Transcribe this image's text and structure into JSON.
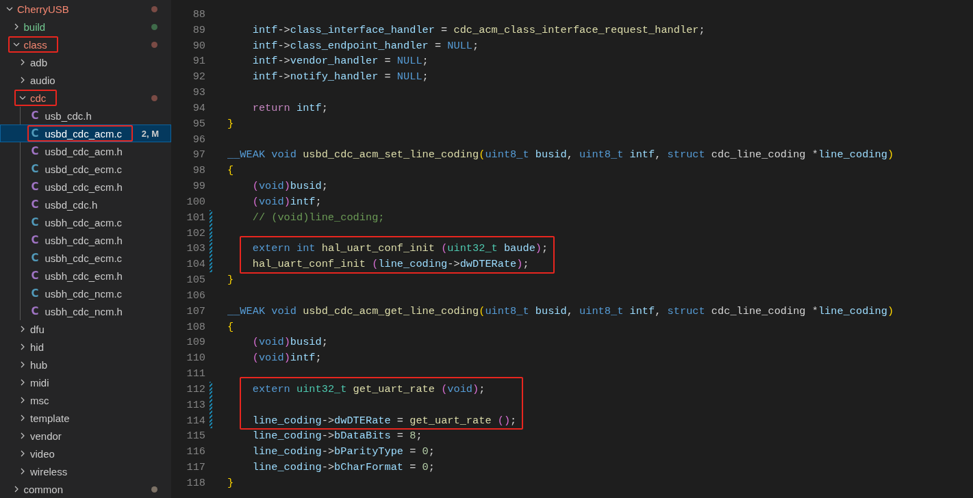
{
  "explorer": {
    "tree": [
      {
        "label": "CherryUSB",
        "kind": "folder",
        "expanded": true,
        "has_errors": true,
        "untracked": false,
        "color": "#7a4b45",
        "annotated": false,
        "selected": false,
        "children": [
          {
            "label": "build",
            "kind": "folder",
            "expanded": false,
            "has_errors": false,
            "untracked": true,
            "color": "#3f6b4a",
            "annotated": false,
            "selected": false
          },
          {
            "label": "class",
            "kind": "folder",
            "expanded": true,
            "has_errors": true,
            "untracked": false,
            "color": "#7a4b45",
            "annotated": true,
            "selected": false,
            "children": [
              {
                "label": "adb",
                "kind": "folder",
                "expanded": false,
                "has_errors": false,
                "untracked": false,
                "annotated": false,
                "selected": false
              },
              {
                "label": "audio",
                "kind": "folder",
                "expanded": false,
                "has_errors": false,
                "untracked": false,
                "annotated": false,
                "selected": false
              },
              {
                "label": "cdc",
                "kind": "folder",
                "expanded": true,
                "has_errors": true,
                "untracked": false,
                "color": "#7a4b45",
                "annotated": true,
                "selected": false,
                "children": [
                  {
                    "label": "usb_cdc.h",
                    "kind": "header",
                    "icon": "C",
                    "has_errors": false,
                    "untracked": false,
                    "annotated": false,
                    "selected": false
                  },
                  {
                    "label": "usbd_cdc_acm.c",
                    "kind": "source",
                    "icon": "C",
                    "has_errors": false,
                    "untracked": false,
                    "badge": "2, M",
                    "annotated": true,
                    "selected": true
                  },
                  {
                    "label": "usbd_cdc_acm.h",
                    "kind": "header",
                    "icon": "C",
                    "has_errors": false,
                    "untracked": false,
                    "annotated": false,
                    "selected": false
                  },
                  {
                    "label": "usbd_cdc_ecm.c",
                    "kind": "source",
                    "icon": "C",
                    "has_errors": false,
                    "untracked": false,
                    "annotated": false,
                    "selected": false
                  },
                  {
                    "label": "usbd_cdc_ecm.h",
                    "kind": "header",
                    "icon": "C",
                    "has_errors": false,
                    "untracked": false,
                    "annotated": false,
                    "selected": false
                  },
                  {
                    "label": "usbd_cdc.h",
                    "kind": "header",
                    "icon": "C",
                    "has_errors": false,
                    "untracked": false,
                    "annotated": false,
                    "selected": false
                  },
                  {
                    "label": "usbh_cdc_acm.c",
                    "kind": "source",
                    "icon": "C",
                    "has_errors": false,
                    "untracked": false,
                    "annotated": false,
                    "selected": false
                  },
                  {
                    "label": "usbh_cdc_acm.h",
                    "kind": "header",
                    "icon": "C",
                    "has_errors": false,
                    "untracked": false,
                    "annotated": false,
                    "selected": false
                  },
                  {
                    "label": "usbh_cdc_ecm.c",
                    "kind": "source",
                    "icon": "C",
                    "has_errors": false,
                    "untracked": false,
                    "annotated": false,
                    "selected": false
                  },
                  {
                    "label": "usbh_cdc_ecm.h",
                    "kind": "header",
                    "icon": "C",
                    "has_errors": false,
                    "untracked": false,
                    "annotated": false,
                    "selected": false
                  },
                  {
                    "label": "usbh_cdc_ncm.c",
                    "kind": "source",
                    "icon": "C",
                    "has_errors": false,
                    "untracked": false,
                    "annotated": false,
                    "selected": false
                  },
                  {
                    "label": "usbh_cdc_ncm.h",
                    "kind": "header",
                    "icon": "C",
                    "has_errors": false,
                    "untracked": false,
                    "annotated": false,
                    "selected": false
                  }
                ]
              },
              {
                "label": "dfu",
                "kind": "folder",
                "expanded": false,
                "has_errors": false,
                "untracked": false,
                "annotated": false,
                "selected": false
              },
              {
                "label": "hid",
                "kind": "folder",
                "expanded": false,
                "has_errors": false,
                "untracked": false,
                "annotated": false,
                "selected": false
              },
              {
                "label": "hub",
                "kind": "folder",
                "expanded": false,
                "has_errors": false,
                "untracked": false,
                "annotated": false,
                "selected": false
              },
              {
                "label": "midi",
                "kind": "folder",
                "expanded": false,
                "has_errors": false,
                "untracked": false,
                "annotated": false,
                "selected": false
              },
              {
                "label": "msc",
                "kind": "folder",
                "expanded": false,
                "has_errors": false,
                "untracked": false,
                "annotated": false,
                "selected": false
              },
              {
                "label": "template",
                "kind": "folder",
                "expanded": false,
                "has_errors": false,
                "untracked": false,
                "annotated": false,
                "selected": false
              },
              {
                "label": "vendor",
                "kind": "folder",
                "expanded": false,
                "has_errors": false,
                "untracked": false,
                "annotated": false,
                "selected": false
              },
              {
                "label": "video",
                "kind": "folder",
                "expanded": false,
                "has_errors": false,
                "untracked": false,
                "annotated": false,
                "selected": false
              },
              {
                "label": "wireless",
                "kind": "folder",
                "expanded": false,
                "has_errors": false,
                "untracked": false,
                "annotated": false,
                "selected": false
              }
            ]
          },
          {
            "label": "common",
            "kind": "folder",
            "expanded": false,
            "has_errors": false,
            "untracked": false,
            "color": "#7d7266",
            "annotated": false,
            "selected": false
          }
        ]
      }
    ]
  },
  "editor": {
    "blocks": [
      {
        "annotated": false,
        "lines": [
          {
            "number": "88",
            "modified": false
          },
          {
            "number": "89",
            "modified": false,
            "tokens": [
              {
                "kind": "variable",
                "text": "    intf"
              },
              {
                "kind": "plain",
                "text": "->"
              },
              {
                "kind": "variable",
                "text": "class_interface_handler"
              },
              {
                "kind": "plain",
                "text": " = "
              },
              {
                "kind": "function",
                "text": "cdc_acm_class_interface_request_handler"
              },
              {
                "kind": "plain",
                "text": ";"
              }
            ]
          },
          {
            "number": "90",
            "modified": false,
            "tokens": [
              {
                "kind": "variable",
                "text": "    intf"
              },
              {
                "kind": "plain",
                "text": "->"
              },
              {
                "kind": "variable",
                "text": "class_endpoint_handler"
              },
              {
                "kind": "plain",
                "text": " = "
              },
              {
                "kind": "keyword",
                "text": "NULL"
              },
              {
                "kind": "plain",
                "text": ";"
              }
            ]
          },
          {
            "number": "91",
            "modified": false,
            "tokens": [
              {
                "kind": "variable",
                "text": "    intf"
              },
              {
                "kind": "plain",
                "text": "->"
              },
              {
                "kind": "variable",
                "text": "vendor_handler"
              },
              {
                "kind": "plain",
                "text": " = "
              },
              {
                "kind": "keyword",
                "text": "NULL"
              },
              {
                "kind": "plain",
                "text": ";"
              }
            ]
          },
          {
            "number": "92",
            "modified": false,
            "tokens": [
              {
                "kind": "variable",
                "text": "    intf"
              },
              {
                "kind": "plain",
                "text": "->"
              },
              {
                "kind": "variable",
                "text": "notify_handler"
              },
              {
                "kind": "plain",
                "text": " = "
              },
              {
                "kind": "keyword",
                "text": "NULL"
              },
              {
                "kind": "plain",
                "text": ";"
              }
            ]
          },
          {
            "number": "93",
            "modified": false
          },
          {
            "number": "94",
            "modified": false,
            "tokens": [
              {
                "kind": "control",
                "text": "    return "
              },
              {
                "kind": "variable",
                "text": "intf"
              },
              {
                "kind": "plain",
                "text": ";"
              }
            ]
          },
          {
            "number": "95",
            "modified": false,
            "tokens": [
              {
                "kind": "brace",
                "text": "}"
              }
            ]
          },
          {
            "number": "96",
            "modified": false
          },
          {
            "number": "97",
            "modified": false,
            "tokens": [
              {
                "kind": "keyword",
                "text": "__WEAK void "
              },
              {
                "kind": "function",
                "text": "usbd_cdc_acm_set_line_coding"
              },
              {
                "kind": "brace",
                "text": "("
              },
              {
                "kind": "keyword",
                "text": "uint8_t "
              },
              {
                "kind": "variable",
                "text": "busid"
              },
              {
                "kind": "plain",
                "text": ", "
              },
              {
                "kind": "keyword",
                "text": "uint8_t "
              },
              {
                "kind": "variable",
                "text": "intf"
              },
              {
                "kind": "plain",
                "text": ", "
              },
              {
                "kind": "keyword",
                "text": "struct "
              },
              {
                "kind": "plain",
                "text": "cdc_line_coding *"
              },
              {
                "kind": "variable",
                "text": "line_coding"
              },
              {
                "kind": "brace",
                "text": ")"
              }
            ]
          },
          {
            "number": "98",
            "modified": false,
            "tokens": [
              {
                "kind": "brace",
                "text": "{"
              }
            ]
          },
          {
            "number": "99",
            "modified": false,
            "tokens": [
              {
                "kind": "paren",
                "text": "    ("
              },
              {
                "kind": "keyword",
                "text": "void"
              },
              {
                "kind": "paren",
                "text": ")"
              },
              {
                "kind": "variable",
                "text": "busid"
              },
              {
                "kind": "plain",
                "text": ";"
              }
            ]
          },
          {
            "number": "100",
            "modified": false,
            "tokens": [
              {
                "kind": "paren",
                "text": "    ("
              },
              {
                "kind": "keyword",
                "text": "void"
              },
              {
                "kind": "paren",
                "text": ")"
              },
              {
                "kind": "variable",
                "text": "intf"
              },
              {
                "kind": "plain",
                "text": ";"
              }
            ]
          },
          {
            "number": "101",
            "modified": true,
            "tokens": [
              {
                "kind": "comment",
                "text": "    // (void)line_coding;"
              }
            ]
          },
          {
            "number": "102",
            "modified": true
          }
        ]
      },
      {
        "annotated": true,
        "lines": [
          {
            "number": "103",
            "modified": true,
            "tokens": [
              {
                "kind": "keyword",
                "text": "    extern int "
              },
              {
                "kind": "function",
                "text": "hal_uart_conf_init "
              },
              {
                "kind": "paren",
                "text": "("
              },
              {
                "kind": "type",
                "text": "uint32_t "
              },
              {
                "kind": "variable",
                "text": "baude"
              },
              {
                "kind": "paren",
                "text": ")"
              },
              {
                "kind": "plain",
                "text": ";"
              }
            ]
          },
          {
            "number": "104",
            "modified": true,
            "tokens": [
              {
                "kind": "function",
                "text": "    hal_uart_conf_init "
              },
              {
                "kind": "paren",
                "text": "("
              },
              {
                "kind": "variable",
                "text": "line_coding"
              },
              {
                "kind": "plain",
                "text": "->"
              },
              {
                "kind": "variable",
                "text": "dwDTERate"
              },
              {
                "kind": "paren",
                "text": ")"
              },
              {
                "kind": "plain",
                "text": ";"
              }
            ]
          }
        ]
      },
      {
        "annotated": false,
        "lines": [
          {
            "number": "105",
            "modified": false,
            "tokens": [
              {
                "kind": "brace",
                "text": "}"
              }
            ]
          },
          {
            "number": "106",
            "modified": false
          },
          {
            "number": "107",
            "modified": false,
            "tokens": [
              {
                "kind": "keyword",
                "text": "__WEAK void "
              },
              {
                "kind": "function",
                "text": "usbd_cdc_acm_get_line_coding"
              },
              {
                "kind": "brace",
                "text": "("
              },
              {
                "kind": "keyword",
                "text": "uint8_t "
              },
              {
                "kind": "variable",
                "text": "busid"
              },
              {
                "kind": "plain",
                "text": ", "
              },
              {
                "kind": "keyword",
                "text": "uint8_t "
              },
              {
                "kind": "variable",
                "text": "intf"
              },
              {
                "kind": "plain",
                "text": ", "
              },
              {
                "kind": "keyword",
                "text": "struct "
              },
              {
                "kind": "plain",
                "text": "cdc_line_coding *"
              },
              {
                "kind": "variable",
                "text": "line_coding"
              },
              {
                "kind": "brace",
                "text": ")"
              }
            ]
          },
          {
            "number": "108",
            "modified": false,
            "tokens": [
              {
                "kind": "brace",
                "text": "{"
              }
            ]
          },
          {
            "number": "109",
            "modified": false,
            "tokens": [
              {
                "kind": "paren",
                "text": "    ("
              },
              {
                "kind": "keyword",
                "text": "void"
              },
              {
                "kind": "paren",
                "text": ")"
              },
              {
                "kind": "variable",
                "text": "busid"
              },
              {
                "kind": "plain",
                "text": ";"
              }
            ]
          },
          {
            "number": "110",
            "modified": false,
            "tokens": [
              {
                "kind": "paren",
                "text": "    ("
              },
              {
                "kind": "keyword",
                "text": "void"
              },
              {
                "kind": "paren",
                "text": ")"
              },
              {
                "kind": "variable",
                "text": "intf"
              },
              {
                "kind": "plain",
                "text": ";"
              }
            ]
          },
          {
            "number": "111",
            "modified": false
          }
        ]
      },
      {
        "annotated": true,
        "lines": [
          {
            "number": "112",
            "modified": true,
            "tokens": [
              {
                "kind": "keyword",
                "text": "    extern "
              },
              {
                "kind": "type",
                "text": "uint32_t "
              },
              {
                "kind": "function",
                "text": "get_uart_rate "
              },
              {
                "kind": "paren",
                "text": "("
              },
              {
                "kind": "keyword",
                "text": "void"
              },
              {
                "kind": "paren",
                "text": ")"
              },
              {
                "kind": "plain",
                "text": ";"
              }
            ]
          },
          {
            "number": "113",
            "modified": true
          },
          {
            "number": "114",
            "modified": true,
            "tokens": [
              {
                "kind": "variable",
                "text": "    line_coding"
              },
              {
                "kind": "plain",
                "text": "->"
              },
              {
                "kind": "variable",
                "text": "dwDTERate"
              },
              {
                "kind": "plain",
                "text": " = "
              },
              {
                "kind": "function",
                "text": "get_uart_rate "
              },
              {
                "kind": "paren",
                "text": "()"
              },
              {
                "kind": "plain",
                "text": ";"
              }
            ]
          }
        ]
      },
      {
        "annotated": false,
        "lines": [
          {
            "number": "115",
            "modified": false,
            "tokens": [
              {
                "kind": "variable",
                "text": "    line_coding"
              },
              {
                "kind": "plain",
                "text": "->"
              },
              {
                "kind": "variable",
                "text": "bDataBits"
              },
              {
                "kind": "plain",
                "text": " = "
              },
              {
                "kind": "number",
                "text": "8"
              },
              {
                "kind": "plain",
                "text": ";"
              }
            ]
          },
          {
            "number": "116",
            "modified": false,
            "tokens": [
              {
                "kind": "variable",
                "text": "    line_coding"
              },
              {
                "kind": "plain",
                "text": "->"
              },
              {
                "kind": "variable",
                "text": "bParityType"
              },
              {
                "kind": "plain",
                "text": " = "
              },
              {
                "kind": "number",
                "text": "0"
              },
              {
                "kind": "plain",
                "text": ";"
              }
            ]
          },
          {
            "number": "117",
            "modified": false,
            "tokens": [
              {
                "kind": "variable",
                "text": "    line_coding"
              },
              {
                "kind": "plain",
                "text": "->"
              },
              {
                "kind": "variable",
                "text": "bCharFormat"
              },
              {
                "kind": "plain",
                "text": " = "
              },
              {
                "kind": "number",
                "text": "0"
              },
              {
                "kind": "plain",
                "text": ";"
              }
            ]
          },
          {
            "number": "118",
            "modified": false,
            "tokens": [
              {
                "kind": "brace",
                "text": "}"
              }
            ]
          }
        ]
      }
    ]
  }
}
